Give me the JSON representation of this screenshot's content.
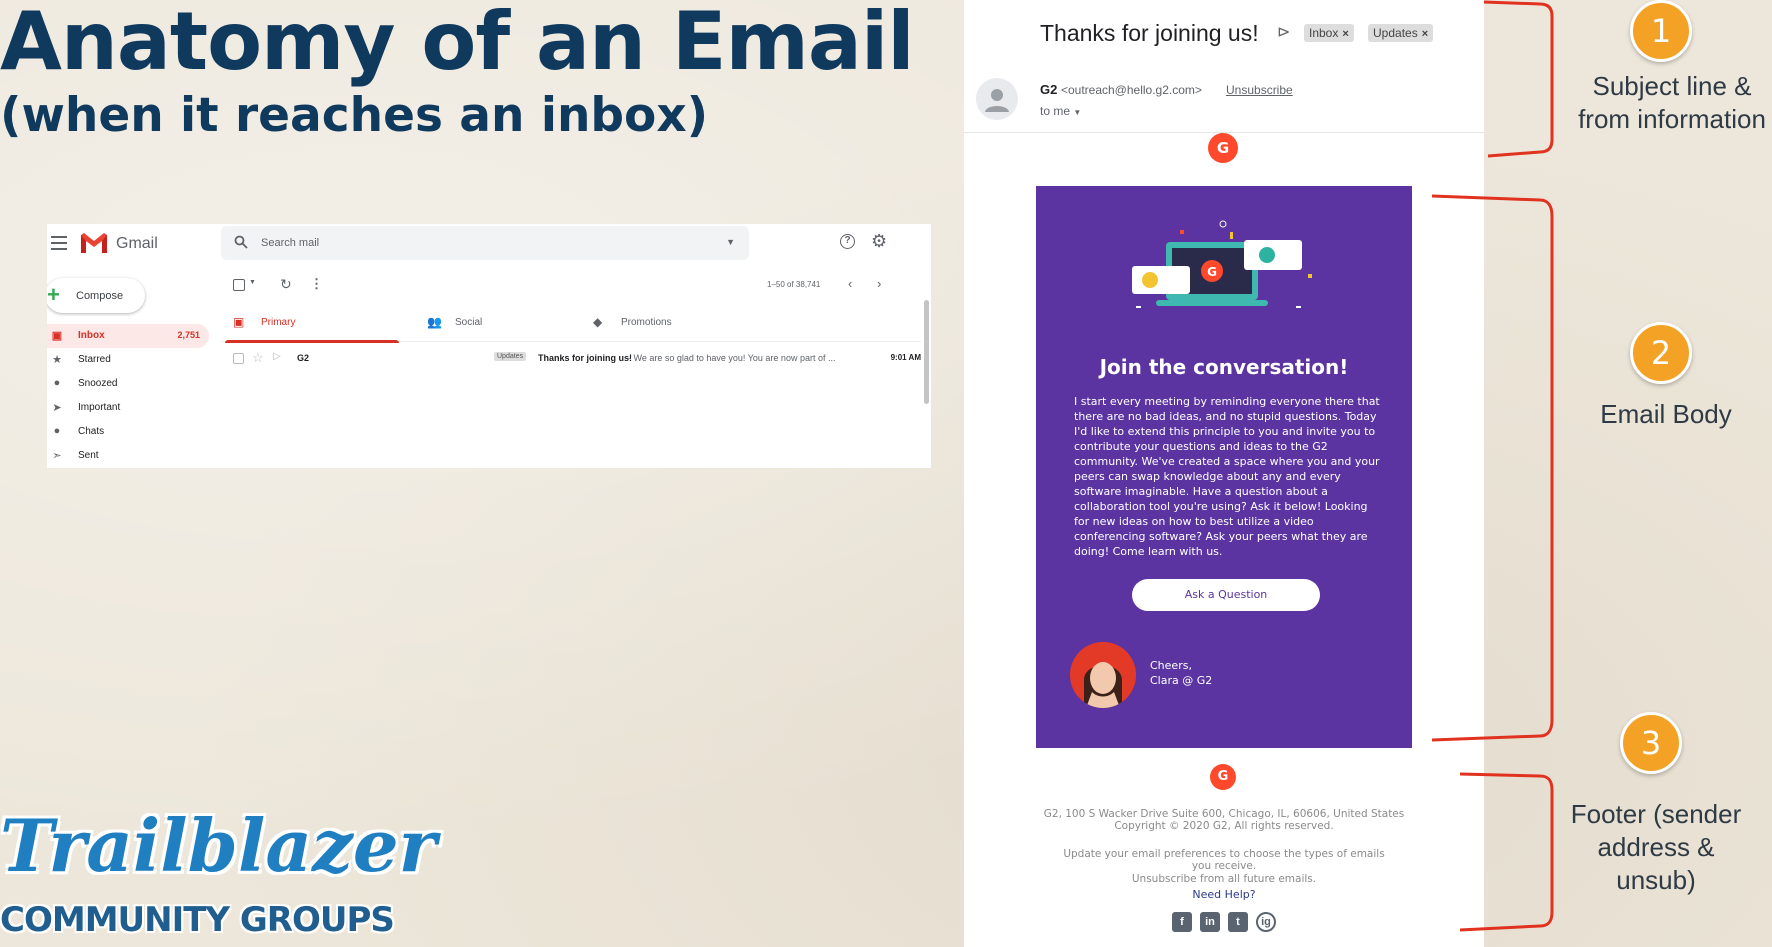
{
  "slide": {
    "title": "Anatomy of an Email",
    "subtitle": "(when it reaches an inbox)"
  },
  "gmail": {
    "brand": "Gmail",
    "search_placeholder": "Search mail",
    "compose_label": "Compose",
    "nav": [
      {
        "label": "Inbox",
        "count": "2,751",
        "icon": "inbox-icon"
      },
      {
        "label": "Starred",
        "count": "",
        "icon": "star-icon"
      },
      {
        "label": "Snoozed",
        "count": "",
        "icon": "clock-icon"
      },
      {
        "label": "Important",
        "count": "",
        "icon": "important-icon"
      },
      {
        "label": "Chats",
        "count": "",
        "icon": "chat-icon"
      },
      {
        "label": "Sent",
        "count": "",
        "icon": "send-icon"
      }
    ],
    "pagination": "1–50 of 38,741",
    "tabs": [
      {
        "label": "Primary",
        "icon": "inbox-icon"
      },
      {
        "label": "Social",
        "icon": "people-icon"
      },
      {
        "label": "Promotions",
        "icon": "tag-icon"
      }
    ],
    "row": {
      "sender": "G2",
      "badge": "Updates",
      "subject": "Thanks for joining us!",
      "snippet": " - We are so glad to have you! You are now part of ...",
      "time": "9:01 AM"
    }
  },
  "email": {
    "subject": "Thanks for joining us!",
    "chips": [
      "Inbox",
      "Updates"
    ],
    "sender_name": "G2",
    "sender_address": "<outreach@hello.g2.com>",
    "unsubscribe": "Unsubscribe",
    "to": "to me",
    "logo_text": "G",
    "card_title": "Join the conversation!",
    "card_body": "I start every meeting by reminding everyone there that there are no bad ideas, and no stupid questions. Today I'd like to extend this principle to you and invite you to contribute your questions and ideas to the G2 community. We've created a space where you and your peers can swap knowledge about any and every software imaginable. Have a question about a collaboration tool you're using? Ask it below! Looking for new ideas on how to best utilize a video conferencing software? Ask your peers what they are doing! Come learn with us.",
    "cta": "Ask a Question",
    "sign_line1": "Cheers,",
    "sign_line2": "Clara @ G2",
    "footer_address": "G2, 100 S Wacker Drive Suite 600, Chicago, IL, 60606, United States",
    "footer_copyright": "Copyright © 2020 G2, All rights reserved.",
    "footer_pref": "Update your email preferences to choose the types of emails you receive.",
    "footer_unsub": "Unsubscribe from all future emails.",
    "need_help": "Need Help?",
    "social": [
      "f",
      "in",
      "t",
      "ig"
    ]
  },
  "callouts": [
    {
      "number": "1",
      "label": "Subject line & from information"
    },
    {
      "number": "2",
      "label": "Email Body"
    },
    {
      "number": "3",
      "label": "Footer (sender address & unsub)"
    }
  ],
  "logo": {
    "script": "Trailblazer",
    "sub": "COMMUNITY GROUPS"
  },
  "colors": {
    "title": "#0f3a5e",
    "card": "#5b34a1",
    "bracket": "#e0321e",
    "callout": "#f4a226",
    "g2": "#ff492c"
  }
}
